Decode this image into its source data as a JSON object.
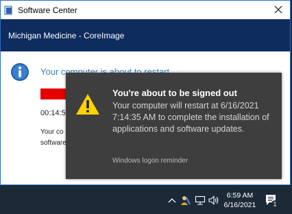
{
  "window": {
    "title": "Software Center",
    "banner_text": "Michigan Medicine - CoreImage",
    "about_text": "Your computer is about to restart",
    "timer_text": "00:14:56",
    "body_line1": "Your co",
    "body_line2": "software"
  },
  "toast": {
    "title": "You're about to be signed out",
    "message": "Your computer will restart at 6/16/2021 7:14:35 AM to complete the installation of applications and software updates.",
    "source": "Windows logon reminder"
  },
  "taskbar": {
    "time": "6:59 AM",
    "date": "6/16/2021",
    "notification_count": "1"
  },
  "colors": {
    "banner": "#0e2c5e",
    "toast_bg": "#3e3e3e",
    "warning": "#ffd200",
    "alert_bar": "#e60000",
    "info": "#1f5fa8"
  },
  "icons": [
    "app-icon",
    "close-icon",
    "info-icon",
    "warning-icon",
    "chevron-up-icon",
    "user-icon",
    "network-icon",
    "volume-icon",
    "notification-icon"
  ]
}
